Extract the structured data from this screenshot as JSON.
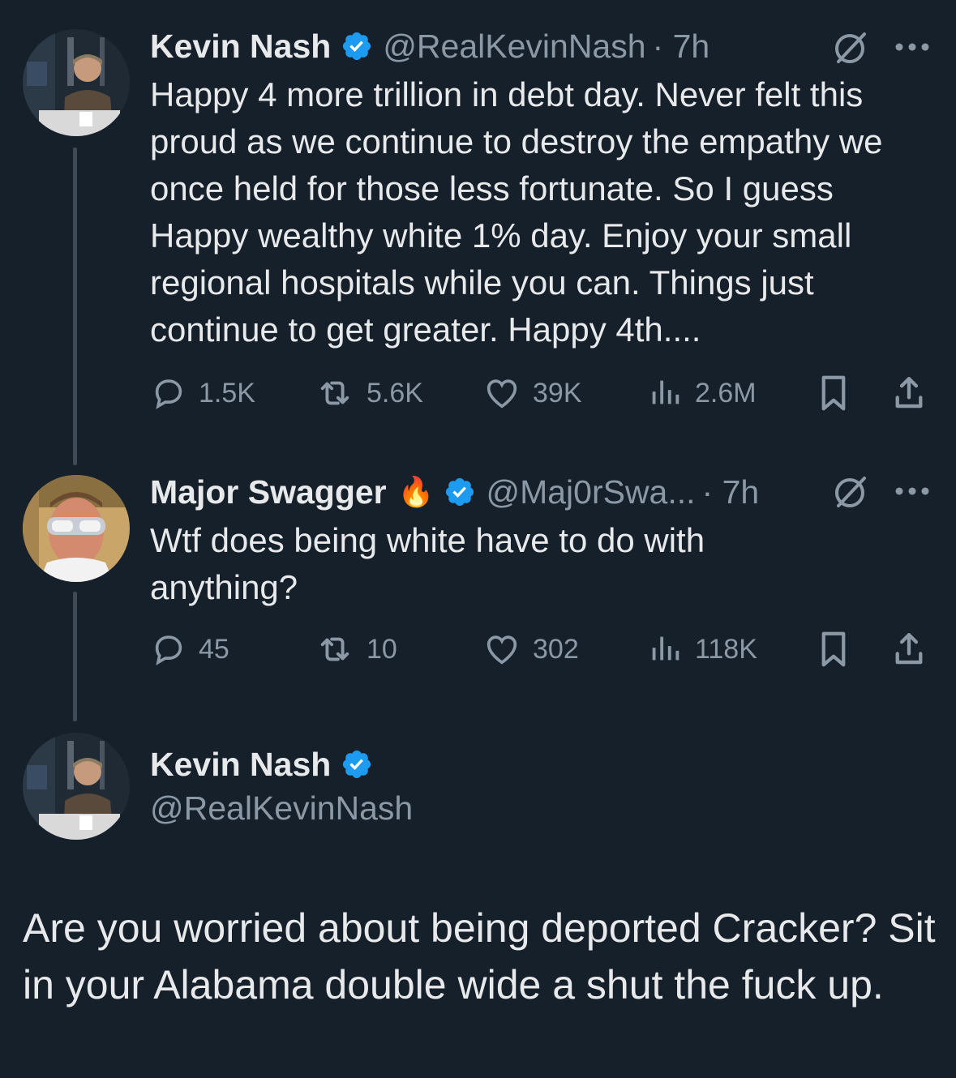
{
  "tweets": [
    {
      "name": "Kevin Nash",
      "handle": "@RealKevinNash",
      "time": "· 7h",
      "text": "Happy 4 more trillion in debt day. Never felt this proud as we continue to destroy the empathy we once held for those less fortunate. So I guess Happy wealthy white 1% day. Enjoy your small regional hospitals while you can. Things just continue to get greater.  Happy 4th....",
      "replies": "1.5K",
      "reposts": "5.6K",
      "likes": "39K",
      "views": "2.6M"
    },
    {
      "name": "Major Swagger",
      "emoji": "🔥",
      "handle": "@Maj0rSwa...",
      "time": "· 7h",
      "text": "Wtf does being white have to do with anything?",
      "replies": "45",
      "reposts": "10",
      "likes": "302",
      "views": "118K"
    },
    {
      "name": "Kevin Nash",
      "handle": "@RealKevinNash",
      "text": "Are you worried about being deported Cracker? Sit in your Alabama double wide a shut the fuck up."
    }
  ],
  "colors": {
    "background": "#15202b",
    "text": "#e7e9ea",
    "muted": "#8b98a5",
    "verified": "#1d9bf0",
    "thread_line": "#3e4a56"
  },
  "icons": [
    "verified-badge-icon",
    "grok-icon",
    "more-icon",
    "reply-icon",
    "repost-icon",
    "like-icon",
    "views-icon",
    "bookmark-icon",
    "share-icon"
  ]
}
